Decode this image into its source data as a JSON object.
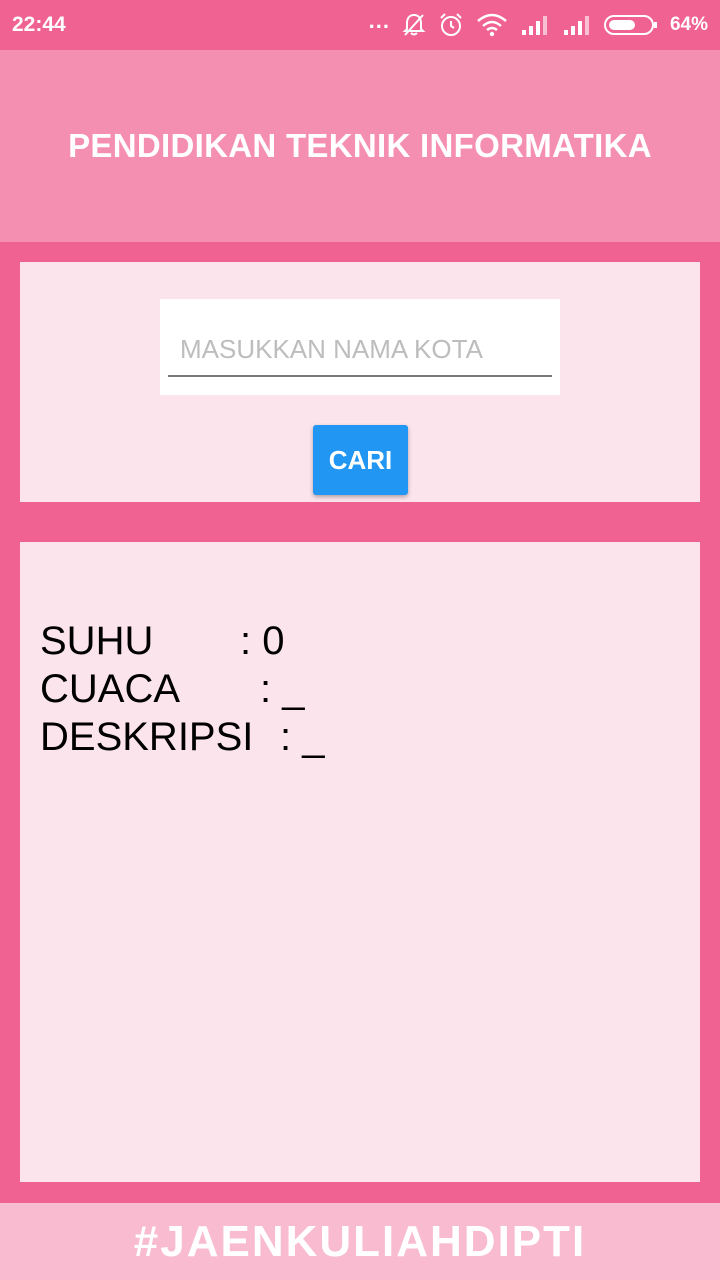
{
  "status_bar": {
    "time": "22:44",
    "more": "...",
    "icons": [
      "mute-notification-icon",
      "alarm-icon",
      "wifi-icon",
      "signal-icon",
      "signal-icon",
      "battery-icon"
    ],
    "battery_percent": "64%",
    "battery_level": 0.64
  },
  "header": {
    "title": "PENDIDIKAN TEKNIK INFORMATIKA"
  },
  "search": {
    "placeholder": "MASUKKAN NAMA KOTA",
    "value": "",
    "button_label": "CARI"
  },
  "result": {
    "rows": [
      {
        "label": "SUHU",
        "value": ": 0"
      },
      {
        "label": "CUACA",
        "value": ": _"
      },
      {
        "label": "DESKRIPSI",
        "value": ": _"
      }
    ]
  },
  "footer": {
    "text": "#JAENKULIAHDIPTI"
  },
  "colors": {
    "primary": "#f06292",
    "header": "#f48fb1",
    "card": "#fce4ec",
    "footer": "#f8bbd0",
    "button": "#2196f3"
  }
}
